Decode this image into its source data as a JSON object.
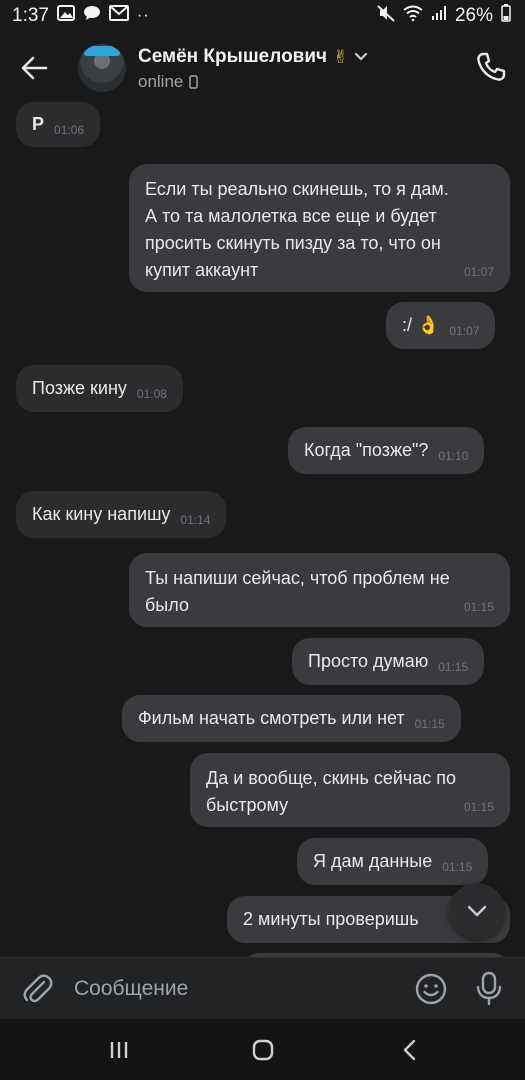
{
  "status_bar": {
    "time": "1:37",
    "battery": "26%",
    "dots": "··"
  },
  "header": {
    "contact_name": "Семён Крышелович",
    "name_emoji": "✌",
    "status": "online"
  },
  "messages": [
    {
      "dir": "in",
      "text": "Р",
      "time": "01:06"
    },
    {
      "dir": "out",
      "text": "Если ты реально скинешь, то я дам.\nА то та малолетка все еще и будет\nпросить скинуть пизду за то, что он\nкупит аккаунт",
      "time": "01:07"
    },
    {
      "dir": "out",
      "text": ":/ 👌",
      "time": "01:07"
    },
    {
      "dir": "in",
      "text": "Позже кину",
      "time": "01:08"
    },
    {
      "dir": "out",
      "text": "Когда \"позже\"?",
      "time": "01:10"
    },
    {
      "dir": "in",
      "text": "Как кину напишу",
      "time": "01:14"
    },
    {
      "dir": "out",
      "text": "Ты напиши сейчас, чтоб проблем не\nбыло",
      "time": "01:15"
    },
    {
      "dir": "out",
      "text": "Просто думаю",
      "time": "01:15"
    },
    {
      "dir": "out",
      "text": "Фильм начать смотреть или нет",
      "time": "01:15"
    },
    {
      "dir": "out",
      "text": "Да и вообще, скинь сейчас по\nбыстрому",
      "time": "01:15"
    },
    {
      "dir": "out",
      "text": "Я дам данные",
      "time": "01:15"
    },
    {
      "dir": "out",
      "text": "2 минуты проверишь",
      "time": ""
    }
  ],
  "composer": {
    "placeholder": "Сообщение"
  },
  "icons": {
    "back": "arrow-left-icon",
    "phone": "phone-icon",
    "attach": "paperclip-icon",
    "emoji": "smile-icon",
    "mic": "microphone-icon",
    "scroll_down": "chevron-down-icon"
  },
  "colors": {
    "background": "#19191a",
    "bubble_in": "#2b2c2e",
    "bubble_out": "#3a3b3e",
    "text": "#e8e9eb",
    "time": "#6f7378"
  }
}
